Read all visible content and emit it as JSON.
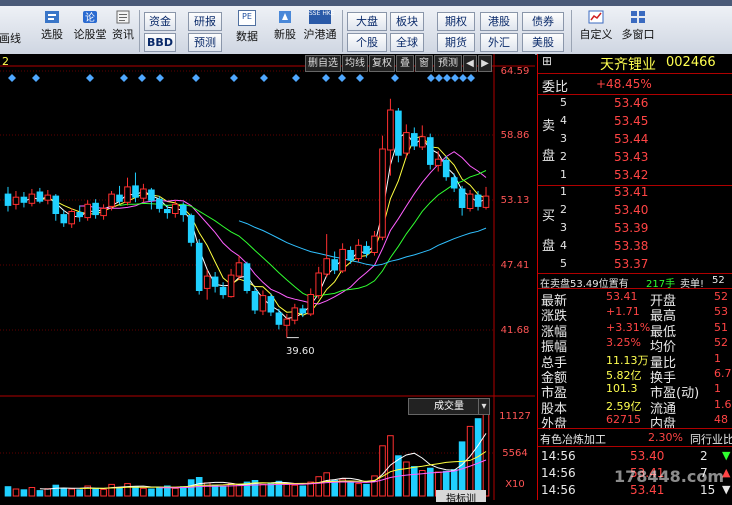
{
  "toolbar": {
    "items": [
      "画线",
      "选股",
      "论股堂",
      "资讯",
      "资金",
      "BBD",
      "研报",
      "预测",
      "数据",
      "新股",
      "沪港通",
      "大盘",
      "个股",
      "板块",
      "全球",
      "期权",
      "期货",
      "港股",
      "外汇",
      "债券",
      "美股",
      "自定义",
      "多窗口"
    ],
    "pe_label": "PE",
    "sse_label": "SSE HKE"
  },
  "chart": {
    "top_left_marker": "2",
    "buttons": [
      "删自选",
      "均线",
      "复权",
      "叠",
      "窗",
      "预测"
    ],
    "price_ticks": [
      "64.59",
      "58.86",
      "53.13",
      "47.41",
      "41.68"
    ],
    "low_label": "39.60",
    "volume_panel_label": "成交量",
    "volume_ticks": [
      "11127",
      "5564",
      "X10"
    ],
    "bottom_tab": "指标训",
    "candles": [
      {
        "o": 53.6,
        "c": 52.5,
        "h": 54.3,
        "l": 51.9
      },
      {
        "o": 52.6,
        "c": 53.3,
        "h": 53.9,
        "l": 52.1
      },
      {
        "o": 53.3,
        "c": 52.8,
        "h": 53.8,
        "l": 52.3
      },
      {
        "o": 52.7,
        "c": 53.6,
        "h": 54.1,
        "l": 52.4
      },
      {
        "o": 53.8,
        "c": 52.9,
        "h": 54.2,
        "l": 52.7
      },
      {
        "o": 53.0,
        "c": 53.5,
        "h": 54.0,
        "l": 52.6
      },
      {
        "o": 53.4,
        "c": 51.7,
        "h": 53.6,
        "l": 51.0
      },
      {
        "o": 51.6,
        "c": 50.8,
        "h": 52.0,
        "l": 50.4
      },
      {
        "o": 50.7,
        "c": 51.9,
        "h": 52.2,
        "l": 50.3
      },
      {
        "o": 51.8,
        "c": 51.4,
        "h": 52.5,
        "l": 50.9
      },
      {
        "o": 51.3,
        "c": 52.6,
        "h": 53.0,
        "l": 51.0
      },
      {
        "o": 52.7,
        "c": 51.6,
        "h": 53.1,
        "l": 51.2
      },
      {
        "o": 51.5,
        "c": 52.2,
        "h": 52.6,
        "l": 51.1
      },
      {
        "o": 52.4,
        "c": 53.6,
        "h": 53.9,
        "l": 52.0
      },
      {
        "o": 53.5,
        "c": 52.9,
        "h": 54.4,
        "l": 52.6
      },
      {
        "o": 52.8,
        "c": 54.3,
        "h": 55.2,
        "l": 52.5
      },
      {
        "o": 54.4,
        "c": 53.3,
        "h": 55.7,
        "l": 52.8
      },
      {
        "o": 53.2,
        "c": 54.1,
        "h": 54.6,
        "l": 52.8
      },
      {
        "o": 54.0,
        "c": 53.0,
        "h": 54.2,
        "l": 52.1
      },
      {
        "o": 53.1,
        "c": 52.2,
        "h": 53.4,
        "l": 51.8
      },
      {
        "o": 52.1,
        "c": 51.8,
        "h": 52.5,
        "l": 51.2
      },
      {
        "o": 51.7,
        "c": 52.6,
        "h": 53.0,
        "l": 51.3
      },
      {
        "o": 52.5,
        "c": 51.6,
        "h": 52.8,
        "l": 50.9
      },
      {
        "o": 51.5,
        "c": 48.9,
        "h": 51.7,
        "l": 48.5
      },
      {
        "o": 48.8,
        "c": 44.2,
        "h": 49.2,
        "l": 43.8
      },
      {
        "o": 44.4,
        "c": 45.6,
        "h": 46.2,
        "l": 43.3
      },
      {
        "o": 45.5,
        "c": 44.6,
        "h": 46.0,
        "l": 44.0
      },
      {
        "o": 44.5,
        "c": 43.8,
        "h": 45.0,
        "l": 43.4
      },
      {
        "o": 43.6,
        "c": 45.7,
        "h": 46.3,
        "l": 43.5
      },
      {
        "o": 45.6,
        "c": 46.9,
        "h": 47.6,
        "l": 45.2
      },
      {
        "o": 46.8,
        "c": 44.2,
        "h": 47.0,
        "l": 43.9
      },
      {
        "o": 44.1,
        "c": 42.3,
        "h": 44.5,
        "l": 41.9
      },
      {
        "o": 42.2,
        "c": 43.7,
        "h": 44.2,
        "l": 41.8
      },
      {
        "o": 43.6,
        "c": 42.1,
        "h": 43.9,
        "l": 41.7
      },
      {
        "o": 42.0,
        "c": 40.9,
        "h": 42.4,
        "l": 40.4
      },
      {
        "o": 40.8,
        "c": 41.4,
        "h": 41.9,
        "l": 39.6
      },
      {
        "o": 41.3,
        "c": 42.5,
        "h": 42.9,
        "l": 40.9
      },
      {
        "o": 42.4,
        "c": 42.0,
        "h": 42.8,
        "l": 41.6
      },
      {
        "o": 41.9,
        "c": 43.8,
        "h": 44.4,
        "l": 41.7
      },
      {
        "o": 43.7,
        "c": 45.9,
        "h": 46.5,
        "l": 43.4
      },
      {
        "o": 45.8,
        "c": 47.3,
        "h": 49.7,
        "l": 45.5
      },
      {
        "o": 47.2,
        "c": 46.2,
        "h": 48.0,
        "l": 45.8
      },
      {
        "o": 46.1,
        "c": 48.2,
        "h": 48.8,
        "l": 45.9
      },
      {
        "o": 48.1,
        "c": 47.2,
        "h": 48.5,
        "l": 46.8
      },
      {
        "o": 47.3,
        "c": 48.6,
        "h": 49.2,
        "l": 47.0
      },
      {
        "o": 48.5,
        "c": 47.8,
        "h": 49.0,
        "l": 47.4
      },
      {
        "o": 47.9,
        "c": 49.5,
        "h": 50.0,
        "l": 47.6
      },
      {
        "o": 49.4,
        "c": 58.0,
        "h": 59.3,
        "l": 49.1
      },
      {
        "o": 57.9,
        "c": 61.8,
        "h": 62.9,
        "l": 55.4
      },
      {
        "o": 61.7,
        "c": 57.4,
        "h": 62.0,
        "l": 56.7
      },
      {
        "o": 57.6,
        "c": 59.6,
        "h": 60.4,
        "l": 57.1
      },
      {
        "o": 59.5,
        "c": 58.3,
        "h": 60.1,
        "l": 57.9
      },
      {
        "o": 58.2,
        "c": 59.2,
        "h": 60.3,
        "l": 57.9
      },
      {
        "o": 59.1,
        "c": 56.5,
        "h": 59.5,
        "l": 56.0
      },
      {
        "o": 56.4,
        "c": 57.0,
        "h": 57.8,
        "l": 55.8
      },
      {
        "o": 56.9,
        "c": 55.3,
        "h": 57.3,
        "l": 54.9
      },
      {
        "o": 55.2,
        "c": 54.2,
        "h": 55.6,
        "l": 53.8
      },
      {
        "o": 54.1,
        "c": 52.3,
        "h": 54.4,
        "l": 51.5
      },
      {
        "o": 52.2,
        "c": 53.6,
        "h": 54.0,
        "l": 51.9
      },
      {
        "o": 53.5,
        "c": 52.4,
        "h": 53.9,
        "l": 52.0
      },
      {
        "o": 52.3,
        "c": 53.4,
        "h": 54.3,
        "l": 52.1
      }
    ],
    "volumes": [
      1200,
      900,
      800,
      1100,
      700,
      950,
      1400,
      1000,
      900,
      800,
      1300,
      1000,
      850,
      1500,
      1100,
      1600,
      1200,
      1000,
      900,
      1100,
      1300,
      1000,
      1200,
      2100,
      2400,
      1700,
      1400,
      1200,
      1600,
      1500,
      1800,
      2000,
      1500,
      1700,
      1900,
      1600,
      1400,
      1300,
      1800,
      2500,
      3000,
      2000,
      2200,
      1700,
      1600,
      1500,
      2600,
      6500,
      7800,
      5200,
      4400,
      3800,
      3300,
      3600,
      3100,
      3200,
      3400,
      7000,
      9000,
      10000,
      11127
    ]
  },
  "quote": {
    "name": "天齐锂业",
    "code": "002466",
    "weibi_label": "委比",
    "weibi_value": "+48.45%",
    "sell_label": "卖盘",
    "buy_label": "买盘",
    "sell": [
      {
        "n": "5",
        "p": "53.46"
      },
      {
        "n": "4",
        "p": "53.45"
      },
      {
        "n": "3",
        "p": "53.44"
      },
      {
        "n": "2",
        "p": "53.43"
      },
      {
        "n": "1",
        "p": "53.42"
      }
    ],
    "buy": [
      {
        "n": "1",
        "p": "53.41"
      },
      {
        "n": "2",
        "p": "53.40"
      },
      {
        "n": "3",
        "p": "53.39"
      },
      {
        "n": "4",
        "p": "53.38"
      },
      {
        "n": "5",
        "p": "53.37"
      }
    ],
    "status_line_a": "在卖盘53.49位置有",
    "status_line_b": "217手",
    "status_line_c": "卖单!",
    "status_line_d": "52",
    "stats": [
      {
        "l": "最新",
        "v": "53.41",
        "l2": "开盘",
        "v2": "52"
      },
      {
        "l": "涨跌",
        "v": "+1.71",
        "l2": "最高",
        "v2": "53"
      },
      {
        "l": "涨幅",
        "v": "+3.31%",
        "l2": "最低",
        "v2": "51"
      },
      {
        "l": "振幅",
        "v": "3.25%",
        "l2": "均价",
        "v2": "52"
      },
      {
        "l": "总手",
        "v": "11.13万",
        "l2": "量比",
        "v2": "1"
      },
      {
        "l": "金额",
        "v": "5.82亿",
        "l2": "换手",
        "v2": "6.7"
      },
      {
        "l": "市盈",
        "v": "101.3",
        "l2": "市盈(动)",
        "v2": "1"
      },
      {
        "l": "股本",
        "v": "2.59亿",
        "l2": "流通",
        "v2": "1.6"
      },
      {
        "l": "外盘",
        "v": "62715",
        "l2": "内盘",
        "v2": "48"
      }
    ],
    "sector_label": "有色冶炼加工",
    "sector_change": "2.30%",
    "sector_extra": "同行业比",
    "ticks": [
      {
        "t": "14:56",
        "p": "53.40",
        "v": "2"
      },
      {
        "t": "14:56",
        "p": "53.41",
        "v": "7"
      },
      {
        "t": "14:56",
        "p": "53.41",
        "v": "15"
      }
    ],
    "watermark": "178448.com"
  },
  "colors": {
    "up": "#ff3030",
    "down": "#20d0ff",
    "ma5": "#ffffff",
    "ma10": "#ffff40",
    "ma20": "#ff60ff",
    "ma30": "#30ff30",
    "ma60": "#30c0ff"
  }
}
